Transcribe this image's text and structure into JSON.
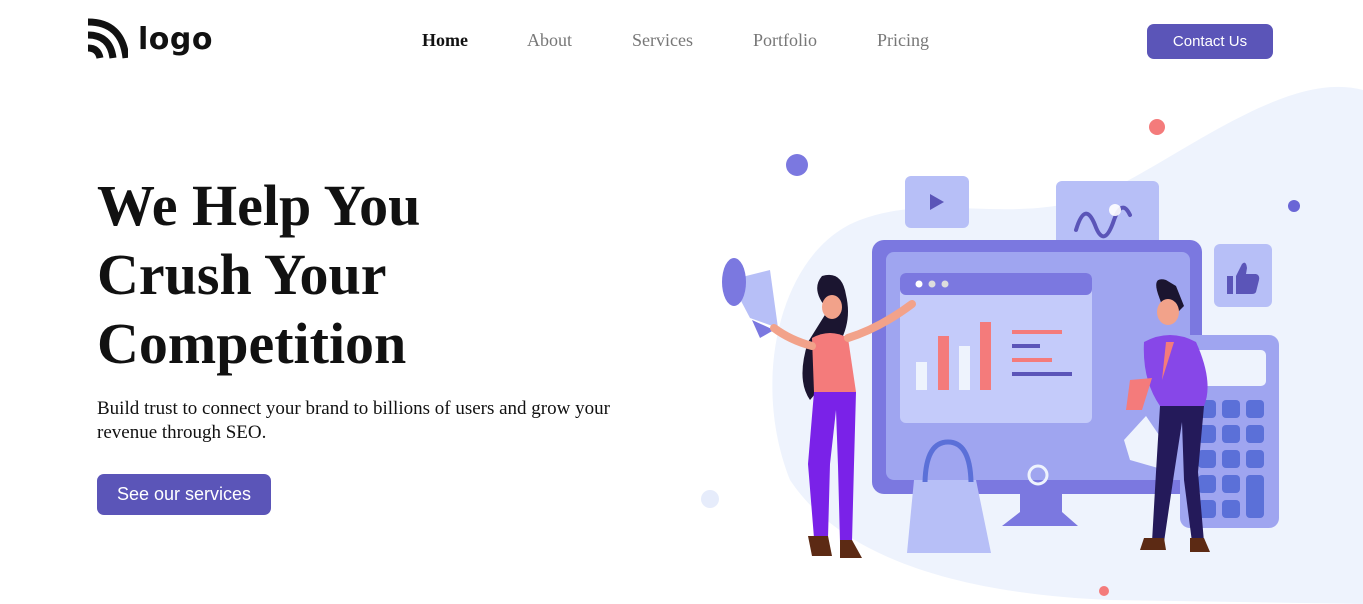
{
  "header": {
    "logo": {
      "icon": "rss-arcs-icon",
      "text": "logo"
    },
    "nav": [
      {
        "label": "Home",
        "active": true
      },
      {
        "label": "About",
        "active": false
      },
      {
        "label": "Services",
        "active": false
      },
      {
        "label": "Portfolio",
        "active": false
      },
      {
        "label": "Pricing",
        "active": false
      }
    ],
    "contact_label": "Contact Us"
  },
  "hero": {
    "headline": [
      "We Help You",
      "Crush Your",
      "Competition"
    ],
    "subtext": "Build trust to connect your brand to billions of users and grow your revenue through SEO.",
    "cta_label": "See our services"
  },
  "colors": {
    "accent": "#5b55b8",
    "illustration_purple": "#7b78e0",
    "illustration_light": "#b7bff7",
    "illustration_coral": "#f47b7b",
    "blob": "#eef3fd"
  }
}
